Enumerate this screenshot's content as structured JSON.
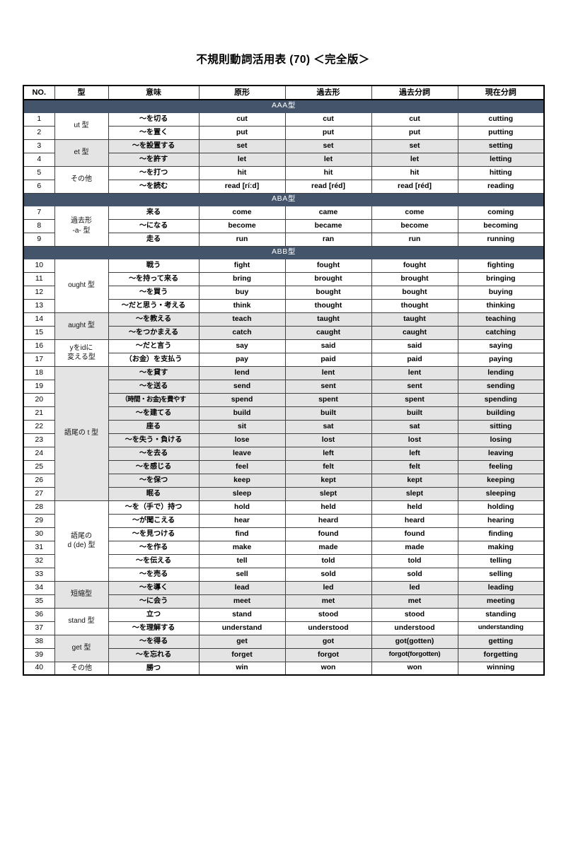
{
  "document": {
    "title": "不規則動詞活用表 (70) ＜完全版＞"
  },
  "table": {
    "columns": [
      "NO.",
      "型",
      "意味",
      "原形",
      "過去形",
      "過去分詞",
      "現在分詞"
    ],
    "sections": [
      {
        "banner": "AAA型",
        "groups": [
          {
            "type": "ut 型",
            "shaded": false,
            "rows": [
              {
                "no": "1",
                "meaning": "～を切る",
                "base": "cut",
                "past": "cut",
                "pp": "cut",
                "ing": "cutting"
              },
              {
                "no": "2",
                "meaning": "～を置く",
                "base": "put",
                "past": "put",
                "pp": "put",
                "ing": "putting"
              }
            ]
          },
          {
            "type": "et 型",
            "shaded": true,
            "rows": [
              {
                "no": "3",
                "meaning": "～を設置する",
                "base": "set",
                "past": "set",
                "pp": "set",
                "ing": "setting"
              },
              {
                "no": "4",
                "meaning": "～を許す",
                "base": "let",
                "past": "let",
                "pp": "let",
                "ing": "letting"
              }
            ]
          },
          {
            "type": "その他",
            "shaded": false,
            "rows": [
              {
                "no": "5",
                "meaning": "～を打つ",
                "base": "hit",
                "past": "hit",
                "pp": "hit",
                "ing": "hitting"
              },
              {
                "no": "6",
                "meaning": "～を読む",
                "base": "read [ríːd]",
                "past": "read [réd]",
                "pp": "read [réd]",
                "ing": "reading"
              }
            ]
          }
        ]
      },
      {
        "banner": "ABA型",
        "groups": [
          {
            "type": "過去形\n-a- 型",
            "shaded": false,
            "rows": [
              {
                "no": "7",
                "meaning": "来る",
                "base": "come",
                "past": "came",
                "pp": "come",
                "ing": "coming"
              },
              {
                "no": "8",
                "meaning": "～になる",
                "base": "become",
                "past": "became",
                "pp": "become",
                "ing": "becoming"
              },
              {
                "no": "9",
                "meaning": "走る",
                "base": "run",
                "past": "ran",
                "pp": "run",
                "ing": "running"
              }
            ]
          }
        ]
      },
      {
        "banner": "ABB型",
        "groups": [
          {
            "type": "ought 型",
            "shaded": false,
            "rows": [
              {
                "no": "10",
                "meaning": "戦う",
                "base": "fight",
                "past": "fought",
                "pp": "fought",
                "ing": "fighting"
              },
              {
                "no": "11",
                "meaning": "～を持って来る",
                "base": "bring",
                "past": "brought",
                "pp": "brought",
                "ing": "bringing"
              },
              {
                "no": "12",
                "meaning": "～を買う",
                "base": "buy",
                "past": "bought",
                "pp": "bought",
                "ing": "buying"
              },
              {
                "no": "13",
                "meaning": "～だと思う・考える",
                "base": "think",
                "past": "thought",
                "pp": "thought",
                "ing": "thinking"
              }
            ]
          },
          {
            "type": "aught 型",
            "shaded": true,
            "rows": [
              {
                "no": "14",
                "meaning": "～を教える",
                "base": "teach",
                "past": "taught",
                "pp": "taught",
                "ing": "teaching"
              },
              {
                "no": "15",
                "meaning": "～をつかまえる",
                "base": "catch",
                "past": "caught",
                "pp": "caught",
                "ing": "catching"
              }
            ]
          },
          {
            "type": "yをidに\n変える型",
            "shaded": false,
            "rows": [
              {
                "no": "16",
                "meaning": "～だと言う",
                "base": "say",
                "past": "said",
                "pp": "said",
                "ing": "saying"
              },
              {
                "no": "17",
                "meaning": "（お金）を支払う",
                "base": "pay",
                "past": "paid",
                "pp": "paid",
                "ing": "paying"
              }
            ]
          },
          {
            "type": "語尾の t 型",
            "shaded": true,
            "rows": [
              {
                "no": "18",
                "meaning": "～を貸す",
                "base": "lend",
                "past": "lent",
                "pp": "lent",
                "ing": "lending"
              },
              {
                "no": "19",
                "meaning": "～を送る",
                "base": "send",
                "past": "sent",
                "pp": "sent",
                "ing": "sending"
              },
              {
                "no": "20",
                "meaning": "（時間・お金)を費やす",
                "base": "spend",
                "past": "spent",
                "pp": "spent",
                "ing": "spending"
              },
              {
                "no": "21",
                "meaning": "～を建てる",
                "base": "build",
                "past": "built",
                "pp": "built",
                "ing": "building"
              },
              {
                "no": "22",
                "meaning": "座る",
                "base": "sit",
                "past": "sat",
                "pp": "sat",
                "ing": "sitting"
              },
              {
                "no": "23",
                "meaning": "～を失う・負ける",
                "base": "lose",
                "past": "lost",
                "pp": "lost",
                "ing": "losing"
              },
              {
                "no": "24",
                "meaning": "～を去る",
                "base": "leave",
                "past": "left",
                "pp": "left",
                "ing": "leaving"
              },
              {
                "no": "25",
                "meaning": "～を感じる",
                "base": "feel",
                "past": "felt",
                "pp": "felt",
                "ing": "feeling"
              },
              {
                "no": "26",
                "meaning": "～を保つ",
                "base": "keep",
                "past": "kept",
                "pp": "kept",
                "ing": "keeping"
              },
              {
                "no": "27",
                "meaning": "眠る",
                "base": "sleep",
                "past": "slept",
                "pp": "slept",
                "ing": "sleeping"
              }
            ]
          },
          {
            "type": "語尾の\nd (de) 型",
            "shaded": false,
            "rows": [
              {
                "no": "28",
                "meaning": "～を（手で）持つ",
                "base": "hold",
                "past": "held",
                "pp": "held",
                "ing": "holding"
              },
              {
                "no": "29",
                "meaning": "～が聞こえる",
                "base": "hear",
                "past": "heard",
                "pp": "heard",
                "ing": "hearing"
              },
              {
                "no": "30",
                "meaning": "～を見つける",
                "base": "find",
                "past": "found",
                "pp": "found",
                "ing": "finding"
              },
              {
                "no": "31",
                "meaning": "～を作る",
                "base": "make",
                "past": "made",
                "pp": "made",
                "ing": "making"
              },
              {
                "no": "32",
                "meaning": "～を伝える",
                "base": "tell",
                "past": "told",
                "pp": "told",
                "ing": "telling"
              },
              {
                "no": "33",
                "meaning": "～を売る",
                "base": "sell",
                "past": "sold",
                "pp": "sold",
                "ing": "selling"
              }
            ]
          },
          {
            "type": "短縮型",
            "shaded": true,
            "rows": [
              {
                "no": "34",
                "meaning": "～を導く",
                "base": "lead",
                "past": "led",
                "pp": "led",
                "ing": "leading"
              },
              {
                "no": "35",
                "meaning": "～に会う",
                "base": "meet",
                "past": "met",
                "pp": "met",
                "ing": "meeting"
              }
            ]
          },
          {
            "type": "stand 型",
            "shaded": false,
            "rows": [
              {
                "no": "36",
                "meaning": "立つ",
                "base": "stand",
                "past": "stood",
                "pp": "stood",
                "ing": "standing"
              },
              {
                "no": "37",
                "meaning": "～を理解する",
                "base": "understand",
                "past": "understood",
                "pp": "understood",
                "ing": "understanding"
              }
            ]
          },
          {
            "type": "get 型",
            "shaded": true,
            "rows": [
              {
                "no": "38",
                "meaning": "～を得る",
                "base": "get",
                "past": "got",
                "pp": "got(gotten)",
                "ing": "getting"
              },
              {
                "no": "39",
                "meaning": "～を忘れる",
                "base": "forget",
                "past": "forgot",
                "pp": "forgot(forgotten)",
                "ing": "forgetting"
              }
            ]
          },
          {
            "type": "その他",
            "shaded": false,
            "rows": [
              {
                "no": "40",
                "meaning": "勝つ",
                "base": "win",
                "past": "won",
                "pp": "won",
                "ing": "winning"
              }
            ]
          }
        ]
      }
    ]
  }
}
